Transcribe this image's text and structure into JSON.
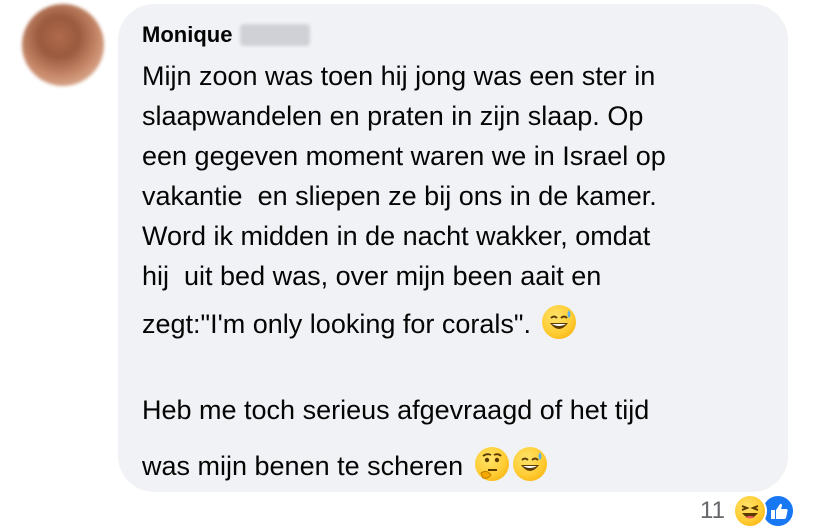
{
  "comment": {
    "author": {
      "first_name": "Monique",
      "last_name_redacted": true
    },
    "lines": [
      "Mijn zoon was toen hij jong was een ster in",
      "slaapwandelen en praten in zijn slaap. Op",
      "een gegeven moment waren we in Israel op",
      "vakantie  en sliepen ze bij ons in de kamer.",
      "Word ik midden in de nacht wakker, omdat",
      "hij  uit bed was, over mijn been aait en",
      "zegt:\"I'm only looking for corals\". ",
      "",
      "Heb me toch serieus afgevraagd of het tijd",
      "was mijn benen te scheren "
    ],
    "emojis": {
      "line7": "grinning-sweat-emoji",
      "line10_a": "thinking-face-emoji",
      "line10_b": "grinning-sweat-emoji"
    }
  },
  "reactions": {
    "count": "11",
    "icons": [
      "laughing-reaction-icon",
      "like-reaction-icon"
    ],
    "like_color": "#1877f2"
  },
  "colors": {
    "bubble_bg": "#f0f2f5",
    "text": "#050505",
    "secondary_text": "#65676b"
  }
}
